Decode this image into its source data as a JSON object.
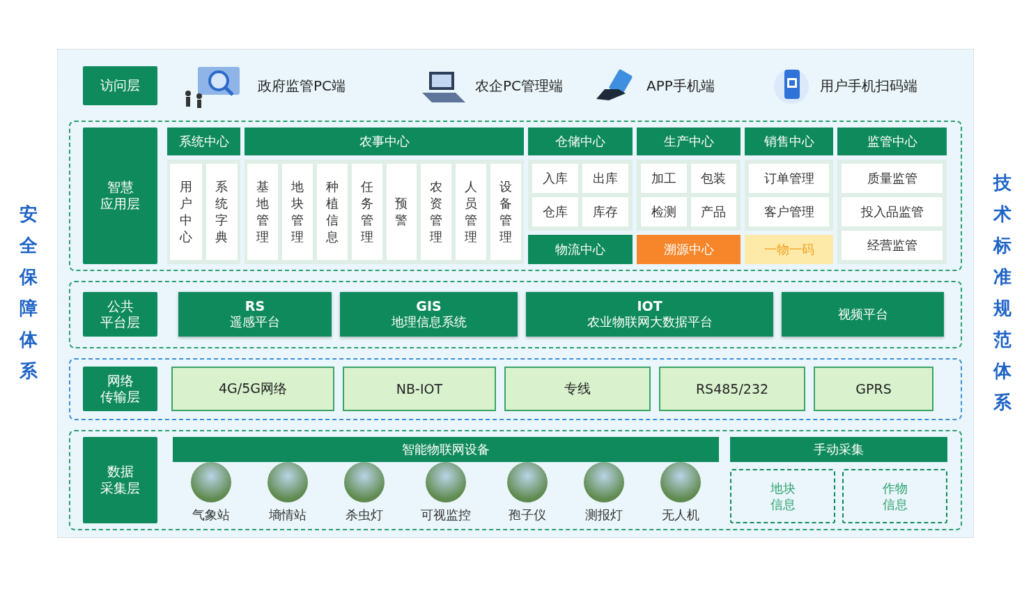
{
  "side_left": "安全保障体系",
  "side_right": "技术标准规范体系",
  "access_layer": {
    "label": "访问层",
    "items": [
      {
        "label": "政府监管PC端",
        "kind": "monitor"
      },
      {
        "label": "农企PC管理端",
        "kind": "laptop"
      },
      {
        "label": "APP手机端",
        "kind": "hand"
      },
      {
        "label": "用户手机扫码端",
        "kind": "scan"
      }
    ]
  },
  "app_layer": {
    "label": [
      "智慧",
      "应用层"
    ],
    "centers": [
      {
        "title": "系统中心",
        "kind": "columns",
        "items": [
          "用户中心",
          "系统字典"
        ]
      },
      {
        "title": "农事中心",
        "kind": "columns",
        "items": [
          "基地管理",
          "地块管理",
          "种植信息",
          "任务管理",
          "预警",
          "农资管理",
          "人员管理",
          "设备管理"
        ]
      },
      {
        "title": "仓储中心",
        "kind": "grid",
        "items": [
          "入库",
          "出库",
          "仓库",
          "库存"
        ]
      },
      {
        "title": "生产中心",
        "kind": "grid",
        "items": [
          "加工",
          "包装",
          "检测",
          "产品"
        ]
      },
      {
        "title": "销售中心",
        "kind": "list",
        "items": [
          "订单管理",
          "客户管理"
        ]
      },
      {
        "title": "监管中心",
        "kind": "list",
        "items": [
          "质量监管",
          "投入品监管",
          "经营监管"
        ]
      }
    ],
    "bottom_row": [
      {
        "label": "物流中心",
        "kind": "header"
      },
      {
        "label": "溯源中心",
        "kind": "highlight"
      },
      {
        "label": "一物一码",
        "kind": "soft"
      }
    ]
  },
  "platform_layer": {
    "label": [
      "公共",
      "平台层"
    ],
    "items": [
      {
        "code": "RS",
        "name": "遥感平台"
      },
      {
        "code": "GIS",
        "name": "地理信息系统"
      },
      {
        "code": "IOT",
        "name": "农业物联网大数据平台"
      },
      {
        "name": "视频平台"
      }
    ]
  },
  "network_layer": {
    "label": [
      "网络",
      "传输层"
    ],
    "items": [
      "4G/5G网络",
      "NB-IOT",
      "专线",
      "RS485/232",
      "GPRS"
    ]
  },
  "collection_layer": {
    "label": [
      "数据",
      "采集层"
    ],
    "iot_title": "智能物联网设备",
    "devices": [
      "气象站",
      "墒情站",
      "杀虫灯",
      "可视监控",
      "孢子仪",
      "测报灯",
      "无人机"
    ],
    "manual_title": "手动采集",
    "manual_items": [
      [
        "地块",
        "信息"
      ],
      [
        "作物",
        "信息"
      ]
    ]
  }
}
